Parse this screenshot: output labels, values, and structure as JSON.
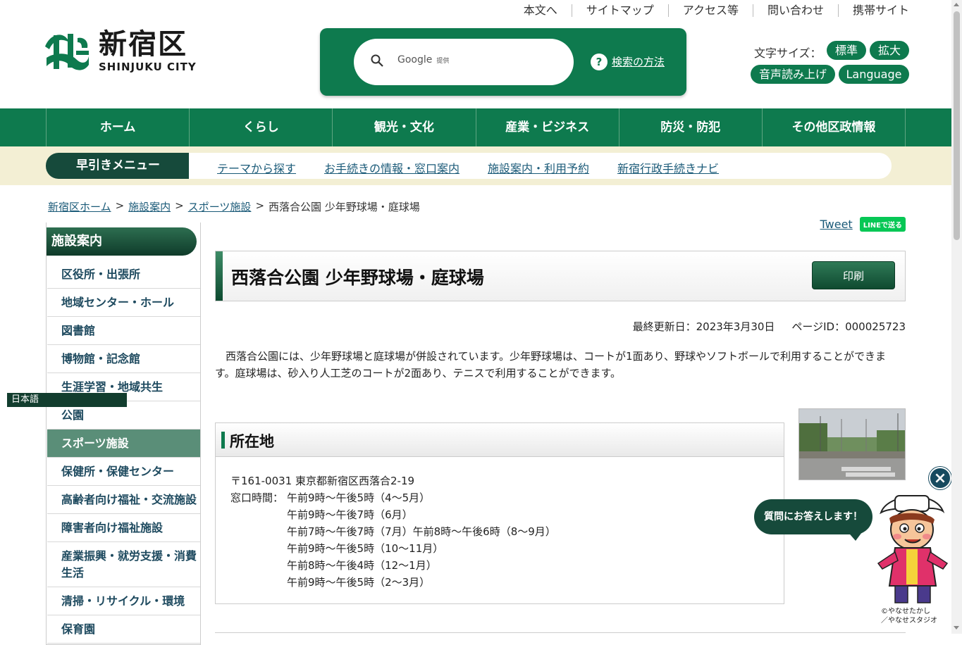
{
  "header": {
    "util_nav": [
      "本文へ",
      "サイトマップ",
      "アクセス等",
      "問い合わせ",
      "携帯サイト"
    ],
    "logo_title": "新宿区",
    "logo_subtitle": "SHINJUKU CITY",
    "search": {
      "brand": "Google",
      "brand_suffix": "提供",
      "help_icon": "?",
      "help_label": "検索の方法"
    },
    "text_size_label": "文字サイズ：",
    "size_standard": "標準",
    "size_large": "拡大",
    "voice_read": "音声読み上げ",
    "language": "Language"
  },
  "global_nav": [
    "ホーム",
    "くらし",
    "観光・文化",
    "産業・ビジネス",
    "防災・防犯",
    "その他区政情報"
  ],
  "quick_menu": {
    "title": "早引きメニュー",
    "links": [
      "テーマから探す",
      "お手続きの情報・窓口案内",
      "施設案内・利用予約",
      "新宿行政手続きナビ"
    ]
  },
  "breadcrumb": {
    "links": [
      "新宿区ホーム",
      "施設案内",
      "スポーツ施設"
    ],
    "separator": ">",
    "current": "西落合公園 少年野球場・庭球場"
  },
  "sidebar": {
    "title": "施設案内",
    "items": [
      "区役所・出張所",
      "地域センター・ホール",
      "図書館",
      "博物館・記念館",
      "生涯学習・地域共生",
      "公園",
      "スポーツ施設",
      "保健所・保健センター",
      "高齢者向け福祉・交流施設",
      "障害者向け福祉施設",
      "産業振興・就労支援・消費生活",
      "清掃・リサイクル・環境",
      "保育園"
    ],
    "active_index": 6
  },
  "language_selector": "日本語",
  "social": {
    "tweet": "Tweet",
    "line": "LINEで送る"
  },
  "page": {
    "title": "西落合公園 少年野球場・庭球場",
    "print": "印刷",
    "last_updated": "最終更新日：2023年3月30日",
    "page_id": "ページID：000025723",
    "intro": "西落合公園には、少年野球場と庭球場が併設されています。少年野球場は、コートが1面あり、野球やソフトボールで利用することができます。庭球場は、砂入り人工芝のコートが2面あり、テニスで利用することができます。"
  },
  "location": {
    "heading": "所在地",
    "address": "〒161-0031 東京都新宿区西落合2-19",
    "hours_label": "窓口時間：",
    "hours": [
      "午前9時～午後5時（4～5月）",
      "午前9時～午後7時（6月）",
      "午前7時～午後7時（7月）午前8時～午後6時（8～9月）",
      "午前9時～午後5時（10～11月）",
      "午前8時～午後4時（12～1月）",
      "午前9時～午後5時（2～3月）"
    ]
  },
  "chat": {
    "bubble": "質問にお答えします！",
    "close": "×",
    "credit_line1": "©やなせたかし",
    "credit_line2": "／やなせスタジオ"
  },
  "colors": {
    "brand_green": "#0e7a4e",
    "dark_green": "#164a3b",
    "quick_bg": "#f3efd4",
    "link": "#1a5a78"
  }
}
